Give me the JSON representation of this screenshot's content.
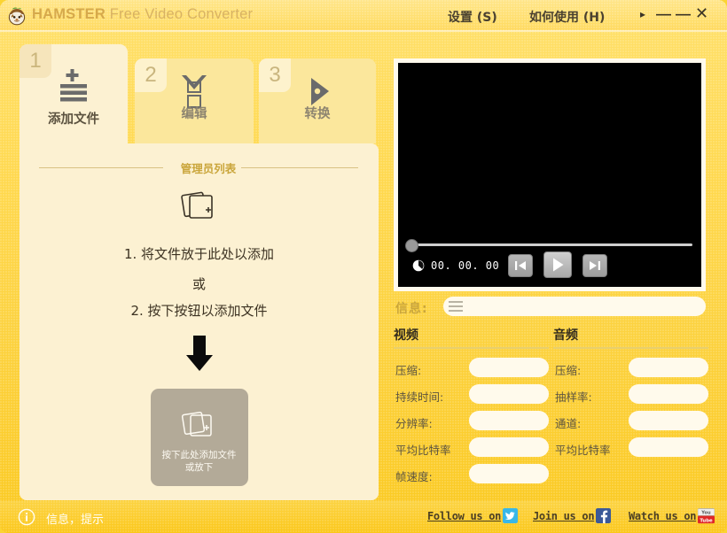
{
  "window": {
    "brand": "HAMSTER",
    "app_name": "Free Video Converter",
    "logo_icon": "hamster-logo-icon",
    "menus": [
      {
        "label": "设置 (S)",
        "name": "menu-settings"
      },
      {
        "label": "如何使用 (H)",
        "name": "menu-help"
      }
    ],
    "controls": {
      "more": "▸",
      "minimize": "—",
      "maximize": "—",
      "close": "✕"
    }
  },
  "tabs": [
    {
      "number": "1",
      "label": "添加文件",
      "icon": "add-files-icon",
      "active": true
    },
    {
      "number": "2",
      "label": "编辑",
      "icon": "edit-checkbox-icon",
      "active": false
    },
    {
      "number": "3",
      "label": "转换",
      "icon": "convert-play-icon",
      "active": false
    }
  ],
  "left_panel": {
    "section_title": "管理员列表",
    "drop_icon": "files-stack-add-icon",
    "hint_line1": "1. 将文件放于此处以添加",
    "hint_or": "或",
    "hint_line2": "2. 按下按钮以添加文件",
    "arrow_icon": "arrow-down-icon",
    "add_button": {
      "icon": "files-stack-add-icon",
      "line1": "按下此处添加文件",
      "line2": "或放下"
    }
  },
  "player": {
    "time": "00. 00. 00",
    "clock_icon": "clock-icon",
    "seek_value": 0,
    "buttons": [
      {
        "name": "prev-button",
        "icon": "skip-previous-icon"
      },
      {
        "name": "play-button",
        "icon": "play-icon"
      },
      {
        "name": "next-button",
        "icon": "skip-next-icon"
      }
    ]
  },
  "info": {
    "label": "信息:",
    "menu_icon": "hamburger-icon",
    "value": "",
    "video": {
      "heading": "视频",
      "fields": [
        {
          "label": "压缩:",
          "value": ""
        },
        {
          "label": "持续时间:",
          "value": ""
        },
        {
          "label": "分辨率:",
          "value": ""
        },
        {
          "label": "平均比特率",
          "value": ""
        },
        {
          "label": "帧速度:",
          "value": ""
        }
      ]
    },
    "audio": {
      "heading": "音频",
      "fields": [
        {
          "label": "压缩:",
          "value": ""
        },
        {
          "label": "抽样率:",
          "value": ""
        },
        {
          "label": "通道:",
          "value": ""
        },
        {
          "label": "平均比特率",
          "value": ""
        }
      ]
    }
  },
  "status": {
    "icon": "info-circle-icon",
    "text": "信息，提示"
  },
  "social": [
    {
      "label": "Follow us on",
      "icon": "twitter-icon",
      "name": "social-twitter"
    },
    {
      "label": "Join us on",
      "icon": "facebook-icon",
      "name": "social-facebook"
    },
    {
      "label": "Watch us on",
      "icon": "youtube-icon",
      "name": "social-youtube"
    }
  ],
  "colors": {
    "brand_yellow": "#fbd433",
    "panel_cream": "#fcf1d2",
    "accent_gold": "#caa63c",
    "tab_inactive": "#fbe79c"
  }
}
